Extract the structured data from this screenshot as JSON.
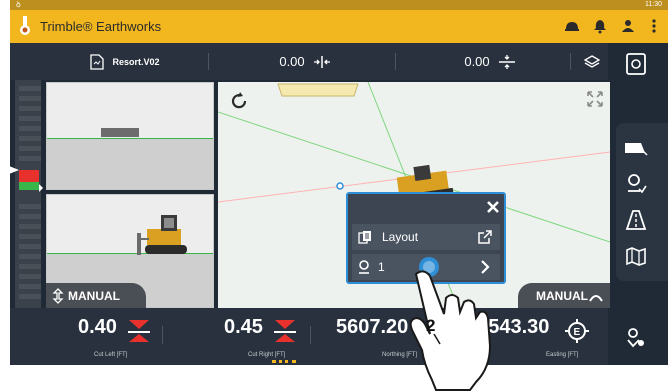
{
  "status_bar": {
    "time": "11:30",
    "signal_icon": "signal-icon"
  },
  "app": {
    "title": "Trimble® Earthworks"
  },
  "header_icons": [
    "helmet-icon",
    "bell-icon",
    "person-icon",
    "more-vert-icon"
  ],
  "info_bar": {
    "file_name": "Resort.V02",
    "value_1": "0.00",
    "value_2": "0.00"
  },
  "views": {
    "left_mode": "MANUAL",
    "right_mode": "MANUAL"
  },
  "popup": {
    "item_label": "Layout",
    "point_number": "1"
  },
  "bottom_bar": {
    "cut_left": {
      "value": "0.40",
      "label": "Cut Left [FT]"
    },
    "cut_right": {
      "value": "0.45",
      "label": "Cut Right [FT]"
    },
    "northing": {
      "value": "5607.20",
      "label": "Northing [FT]"
    },
    "easting": {
      "value": "10543.30",
      "label": "Easting [FT]"
    }
  },
  "annotation": {
    "step_number": "2"
  },
  "colors": {
    "app_bar": "#f2b71f",
    "status_bar": "#bc8f1f",
    "dark_bg": "#1f2a36",
    "cut_red": "#e8312d",
    "fill_green": "#39b54a",
    "popup_border": "#2f8fd6"
  }
}
